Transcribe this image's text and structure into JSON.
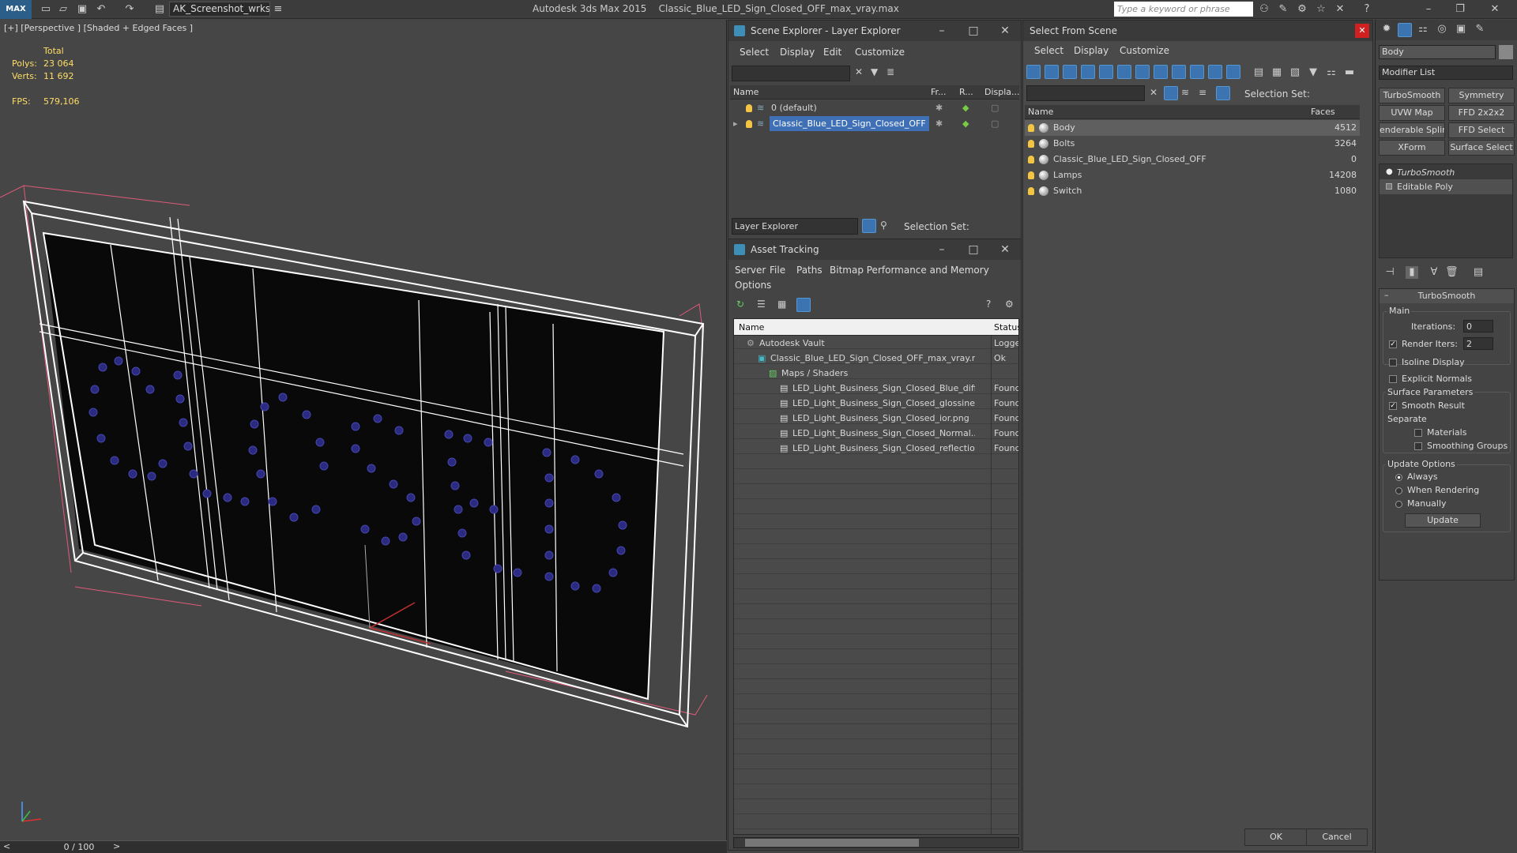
{
  "app": {
    "title": "Autodesk 3ds Max  2015",
    "file": "Classic_Blue_LED_Sign_Closed_OFF_max_vray.max",
    "logo": "MAX",
    "workspace": "AK_Screenshot_wrksp",
    "search_placeholder": "Type a keyword or phrase"
  },
  "viewport": {
    "label": "[+] [Perspective ] [Shaded + Edged Faces ]",
    "stats": {
      "total_label": "Total",
      "polys_label": "Polys:",
      "polys": "23 064",
      "verts_label": "Verts:",
      "verts": "11 692",
      "fps_label": "FPS:",
      "fps": "579,106"
    }
  },
  "timeline": {
    "frame": "0 / 100",
    "prev": "<",
    "next": ">"
  },
  "scene_explorer": {
    "title": "Scene Explorer - Layer Explorer",
    "menu": [
      "Select",
      "Display",
      "Edit",
      "Customize"
    ],
    "columns": [
      "Name",
      "Fr...",
      "R...",
      "Displa..."
    ],
    "rows": [
      {
        "name": "0 (default)",
        "selected": false
      },
      {
        "name": "Classic_Blue_LED_Sign_Closed_OFF",
        "selected": true
      }
    ],
    "footer_dropdown": "Layer Explorer",
    "selection_set_label": "Selection Set:"
  },
  "asset_tracking": {
    "title": "Asset Tracking",
    "menu": [
      "Server",
      "File",
      "Paths",
      "Bitmap Performance and Memory",
      "Options"
    ],
    "columns": [
      "Name",
      "Status"
    ],
    "rows": [
      {
        "name": "Autodesk Vault",
        "status": "Logged",
        "indent": 1
      },
      {
        "name": "Classic_Blue_LED_Sign_Closed_OFF_max_vray.max",
        "status": "Ok",
        "indent": 2
      },
      {
        "name": "Maps / Shaders",
        "status": "",
        "indent": 3
      },
      {
        "name": "LED_Light_Business_Sign_Closed_Blue_diff...",
        "status": "Found",
        "indent": 4
      },
      {
        "name": "LED_Light_Business_Sign_Closed_glossines...",
        "status": "Found",
        "indent": 4
      },
      {
        "name": "LED_Light_Business_Sign_Closed_ior.png",
        "status": "Found",
        "indent": 4
      },
      {
        "name": "LED_Light_Business_Sign_Closed_Normal....",
        "status": "Found",
        "indent": 4
      },
      {
        "name": "LED_Light_Business_Sign_Closed_reflectio...",
        "status": "Found",
        "indent": 4
      }
    ]
  },
  "select_from_scene": {
    "title": "Select From Scene",
    "menu": [
      "Select",
      "Display",
      "Customize"
    ],
    "selection_set_label": "Selection Set:",
    "columns": [
      "Name",
      "Faces"
    ],
    "rows": [
      {
        "name": "Body",
        "faces": "4512",
        "selected": true
      },
      {
        "name": "Bolts",
        "faces": "3264",
        "selected": false
      },
      {
        "name": "Classic_Blue_LED_Sign_Closed_OFF",
        "faces": "0",
        "selected": false
      },
      {
        "name": "Lamps",
        "faces": "14208",
        "selected": false
      },
      {
        "name": "Switch",
        "faces": "1080",
        "selected": false
      }
    ],
    "ok": "OK",
    "cancel": "Cancel"
  },
  "command_panel": {
    "object_name": "Body",
    "modifier_list": "Modifier List",
    "buttons": [
      "TurboSmooth",
      "Symmetry",
      "UVW Map",
      "FFD 2x2x2",
      "enderable Splir",
      "FFD Select",
      "XForm",
      "Surface Select"
    ],
    "stack": [
      "TurboSmooth",
      "Editable Poly"
    ],
    "rollout_title": "TurboSmooth",
    "main_label": "Main",
    "iterations_label": "Iterations:",
    "iterations": "0",
    "render_iters_label": "Render Iters:",
    "render_iters": "2",
    "isoline": "Isoline Display",
    "explicit_normals": "Explicit Normals",
    "surface_params": "Surface Parameters",
    "smooth_result": "Smooth Result",
    "separate": "Separate",
    "materials": "Materials",
    "smoothing_groups": "Smoothing Groups",
    "update_options": "Update Options",
    "always": "Always",
    "when_rendering": "When Rendering",
    "manually": "Manually",
    "update": "Update"
  }
}
